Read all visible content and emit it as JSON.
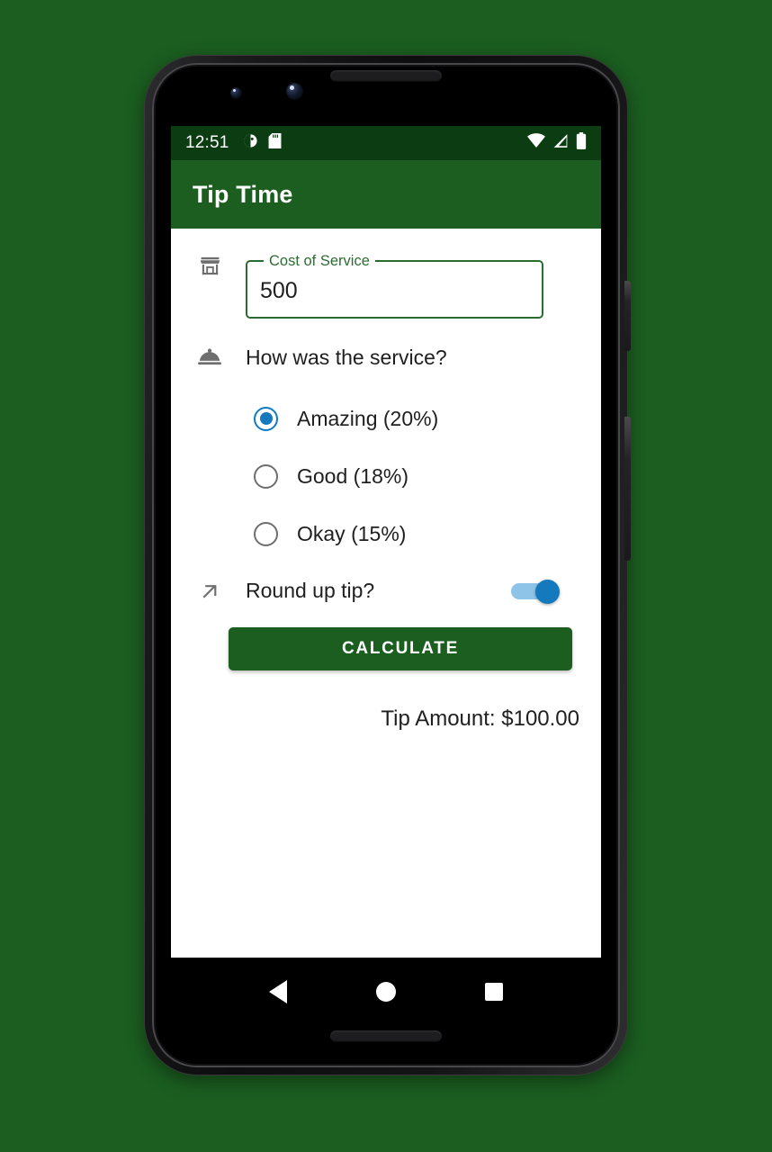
{
  "status_bar": {
    "time": "12:51",
    "left_icons": [
      "do-not-disturb-icon",
      "sd-card-icon"
    ],
    "right_icons": [
      "wifi-icon",
      "cell-signal-icon",
      "battery-icon"
    ],
    "background_color": "#0c3d12"
  },
  "app_bar": {
    "title": "Tip Time",
    "background_color": "#1b5e20",
    "text_color": "#ffffff"
  },
  "form": {
    "cost_field": {
      "icon": "store-icon",
      "label": "Cost of Service",
      "value": "500",
      "placeholder": "Cost of Service",
      "border_color": "#2a6b30"
    },
    "service_question": {
      "icon": "room-service-icon",
      "label": "How was the service?"
    },
    "service_options": [
      {
        "label": "Amazing (20%)",
        "selected": true
      },
      {
        "label": "Good (18%)",
        "selected": false
      },
      {
        "label": "Okay (15%)",
        "selected": false
      }
    ],
    "round_up": {
      "icon": "arrow-up-right-icon",
      "label": "Round up tip?",
      "enabled": true,
      "accent_color": "#1579bd"
    },
    "calculate_button": {
      "label": "CALCULATE",
      "background_color": "#1b5e20"
    },
    "result": "Tip Amount: $100.00"
  },
  "nav_bar": {
    "buttons": [
      "back-button",
      "home-button",
      "recents-button"
    ]
  },
  "page": {
    "background_color": "#1b5e20"
  }
}
